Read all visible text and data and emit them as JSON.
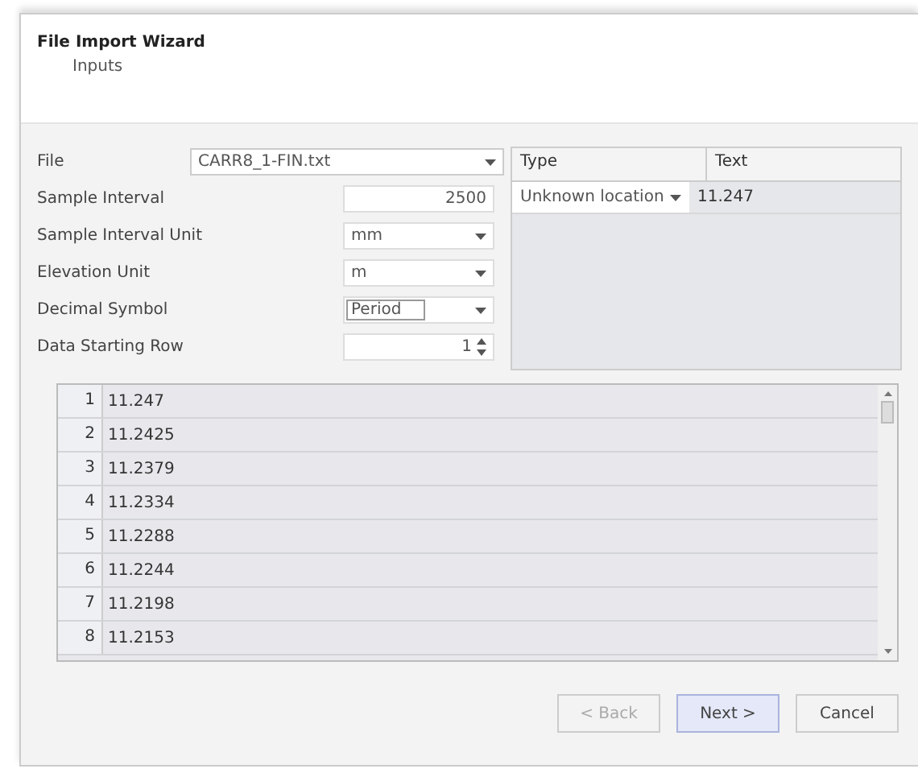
{
  "wizard": {
    "title": "File Import Wizard",
    "subtitle": "Inputs"
  },
  "form": [
    {
      "kind": "file",
      "label": "File",
      "value": "CARR8_1-FIN.txt"
    },
    {
      "kind": "number",
      "label": "Sample Interval",
      "value": "2500"
    },
    {
      "kind": "combo",
      "label": "Sample Interval Unit",
      "value": "mm"
    },
    {
      "kind": "combo",
      "label": "Elevation Unit",
      "value": "m"
    },
    {
      "kind": "select",
      "label": "Decimal Symbol",
      "value": "Period"
    },
    {
      "kind": "spin",
      "label": "Data Starting Row",
      "value": "1"
    }
  ],
  "columns_table": {
    "headers": [
      "Type",
      "Text"
    ],
    "rows": [
      {
        "type": "Unknown location",
        "text": "11.247"
      }
    ]
  },
  "data_rows": [
    {
      "index": "1",
      "value": "11.247"
    },
    {
      "index": "2",
      "value": "11.2425"
    },
    {
      "index": "3",
      "value": "11.2379"
    },
    {
      "index": "4",
      "value": "11.2334"
    },
    {
      "index": "5",
      "value": "11.2288"
    },
    {
      "index": "6",
      "value": "11.2244"
    },
    {
      "index": "7",
      "value": "11.2198"
    },
    {
      "index": "8",
      "value": "11.2153"
    }
  ],
  "buttons": [
    {
      "label": "< Back",
      "disabled": true,
      "primary": false
    },
    {
      "label": "Next >",
      "disabled": false,
      "primary": true
    },
    {
      "label": "Cancel",
      "disabled": false,
      "primary": false
    }
  ]
}
